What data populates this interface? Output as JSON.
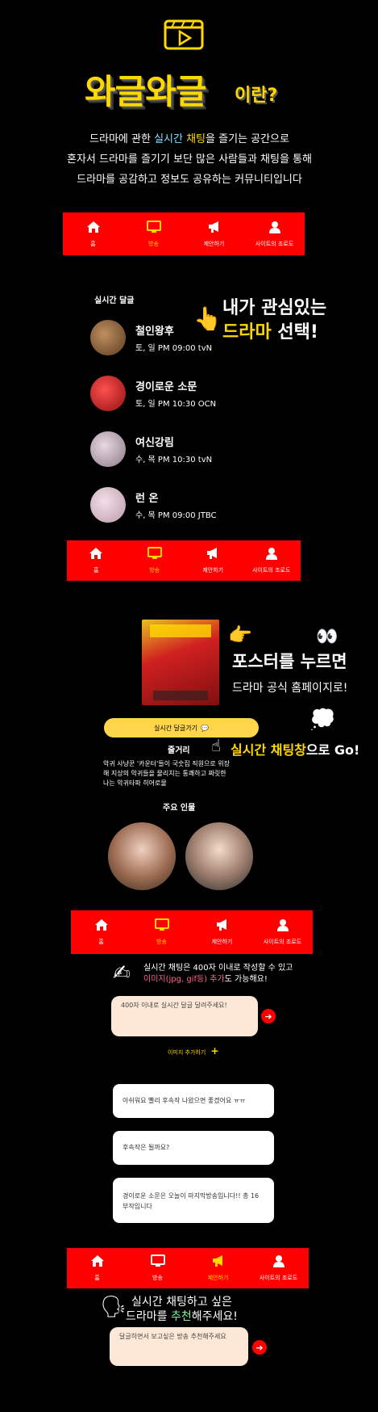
{
  "header": {
    "title_main": "와글와글",
    "title_sub": "이란?",
    "intro_lines": [
      {
        "pre": "드라마에 관한 ",
        "h1": "실시간",
        "mid": " ",
        "h2": "채팅",
        "post": "을 즐기는 공간으로"
      },
      {
        "pre": "혼자서 드라마를 즐기기 보단 많은 사람들과 채팅을 통해",
        "h1": "",
        "mid": "",
        "h2": "",
        "post": ""
      },
      {
        "pre": "드라마를 공감하고 정보도 공유하는 커뮤니티입니다",
        "h1": "",
        "mid": "",
        "h2": "",
        "post": ""
      }
    ]
  },
  "nav": {
    "items": [
      {
        "label": "홈",
        "icon": "home-icon"
      },
      {
        "label": "방송",
        "icon": "tv-icon"
      },
      {
        "label": "제안하기",
        "icon": "megaphone-icon"
      },
      {
        "label": "사이트의 조로도",
        "icon": "user-icon"
      }
    ],
    "bars": [
      {
        "active": 1
      },
      {
        "active": 1
      },
      {
        "active": 1
      },
      {
        "active": 2
      }
    ]
  },
  "drama_list": {
    "label": "실시간 달글",
    "items": [
      {
        "title": "철인왕후",
        "time": "토, 일 PM 09:00 tvN",
        "color": "#8a6a3a"
      },
      {
        "title": "경이로운 소문",
        "time": "토, 일 PM 10:30 OCN",
        "color": "#c0202a"
      },
      {
        "title": "여신강림",
        "time": "수, 목 PM 10:30 tvN",
        "color": "#b6a6b8"
      },
      {
        "title": "런 온",
        "time": "수, 목 PM 09:00 JTBC",
        "color": "#d8c0c8"
      }
    ],
    "callout_line1": "내가 관심있는",
    "callout_line2_hl": "드라마",
    "callout_line2_post": " 선택!"
  },
  "detail": {
    "poster_callout_line1": "포스터를 누르면",
    "poster_callout_line2": "드라마 공식 홈페이지로!",
    "chat_button": "실시간 달글가기",
    "chat_callout_hl": "실시간 채팅창",
    "chat_callout_post": "으로 Go!",
    "synopsis_label": "줄거리",
    "synopsis_text": "악귀 사냥꾼 '카운터'들이 국숫집 직원으로 위장해 지상의 악귀들을 물리치는 통쾌하고 짜릿한 나는 악귀타파 히어로물",
    "cast_label": "주요 인물"
  },
  "chat": {
    "instruction_line1": "실시간 채팅은 400자 이내로 작성할 수 있고",
    "instruction_hl": "이미지(jpg, gif등) 추가",
    "instruction_post": "도 가능해요!",
    "input_placeholder": "400자 이내로 실시간 달글 달려주세요!",
    "add_image": "이미지 추가하기",
    "messages": [
      "아쉬워요 빨리 후속작 나왔으면 좋겠어요 ㅠㅠ",
      "후속작은 될까요?",
      "경이로운 소문은 오늘이 마지막방송입니다!! 총 16부작입니다"
    ]
  },
  "suggest": {
    "line1": "실시간 채팅하고 싶은",
    "line2_pre": "드라마를 ",
    "line2_hl": "추천",
    "line2_post": "해주세요!",
    "input_placeholder": "달글하면서 보고싶은 방송 추천해주세요"
  },
  "colors": {
    "accent_red": "#ff0000",
    "accent_yellow": "#ffd800",
    "accent_green": "#7df29a"
  }
}
